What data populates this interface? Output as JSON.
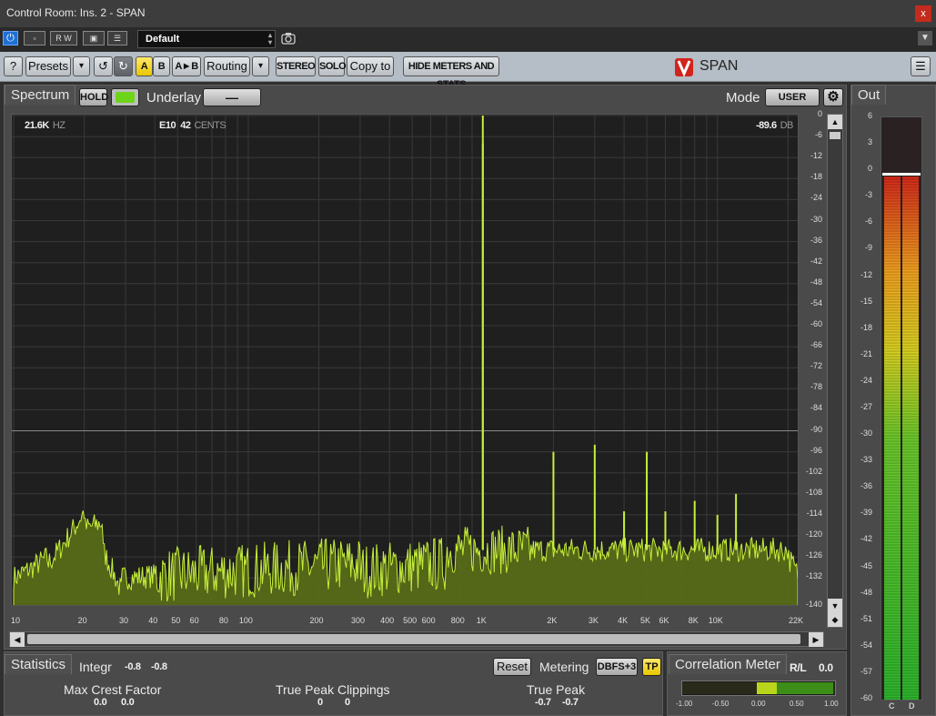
{
  "window": {
    "title": "Control Room: Ins. 2 - SPAN",
    "close_glyph": "x"
  },
  "host_toolbar": {
    "buttons": [
      "power-icon",
      "bypass-icon",
      "R",
      "W",
      "compare-icon",
      "list-icon"
    ],
    "rw_labels": [
      "R",
      "W"
    ],
    "preset_value": "Default",
    "snapshot_icon": "camera-icon"
  },
  "plugin_toolbar": {
    "help": "?",
    "presets": "Presets",
    "dropdown_glyph": "▾",
    "undo_glyph": "↺",
    "redo_glyph": "↻",
    "a": "A",
    "b": "B",
    "a_to_b": "A►B",
    "routing": "Routing",
    "stereo": "STEREO",
    "solo": "SOLO",
    "copy_to": "Copy to",
    "hide_meters": "HIDE METERS AND STATS",
    "logo": "SPAN",
    "menu_icon": "hamburger-icon"
  },
  "spectrum": {
    "tab": "Spectrum",
    "hold": "HOLD",
    "underlay_label": "Underlay",
    "underlay_value": "—",
    "mode_label": "Mode",
    "mode_value": "USER",
    "settings_icon": "gear-icon",
    "readout_freq": "21.6K",
    "readout_freq_unit": "HZ",
    "readout_note": "E10",
    "readout_cents": "42",
    "readout_cents_unit": "CENTS",
    "readout_level": "-89.6",
    "readout_level_unit": "DB",
    "db_ticks": [
      "0",
      "-6",
      "-12",
      "-18",
      "-24",
      "-30",
      "-36",
      "-42",
      "-48",
      "-54",
      "-60",
      "-66",
      "-72",
      "-78",
      "-84",
      "-90",
      "-96",
      "-102",
      "-108",
      "-114",
      "-120",
      "-126",
      "-132",
      "-140"
    ],
    "freq_ticks": [
      {
        "label": "10",
        "hz": 10
      },
      {
        "label": "20",
        "hz": 20
      },
      {
        "label": "30",
        "hz": 30
      },
      {
        "label": "40",
        "hz": 40
      },
      {
        "label": "50",
        "hz": 50
      },
      {
        "label": "60",
        "hz": 60
      },
      {
        "label": "80",
        "hz": 80
      },
      {
        "label": "100",
        "hz": 100
      },
      {
        "label": "200",
        "hz": 200
      },
      {
        "label": "300",
        "hz": 300
      },
      {
        "label": "400",
        "hz": 400
      },
      {
        "label": "500",
        "hz": 500
      },
      {
        "label": "600",
        "hz": 600
      },
      {
        "label": "800",
        "hz": 800
      },
      {
        "label": "1K",
        "hz": 1000
      },
      {
        "label": "2K",
        "hz": 2000
      },
      {
        "label": "3K",
        "hz": 3000
      },
      {
        "label": "4K",
        "hz": 4000
      },
      {
        "label": "5K",
        "hz": 5000
      },
      {
        "label": "6K",
        "hz": 6000
      },
      {
        "label": "8K",
        "hz": 8000
      },
      {
        "label": "10K",
        "hz": 10000
      },
      {
        "label": "22K",
        "hz": 22000
      }
    ],
    "reference_line_db": -90,
    "harmonic_peaks": [
      {
        "hz": 1000,
        "db": 0
      },
      {
        "hz": 1000,
        "db": -8
      },
      {
        "hz": 2000,
        "db": -96
      },
      {
        "hz": 3000,
        "db": -94
      },
      {
        "hz": 4000,
        "db": -113
      },
      {
        "hz": 5000,
        "db": -96
      },
      {
        "hz": 6000,
        "db": -113
      },
      {
        "hz": 8000,
        "db": -110
      },
      {
        "hz": 10000,
        "db": -114
      },
      {
        "hz": 12000,
        "db": -108
      }
    ],
    "scroll_up": "▲",
    "scroll_down": "▼",
    "scroll_left": "◀",
    "scroll_right": "▶",
    "scroll_reset": "◆"
  },
  "statistics": {
    "tab": "Statistics",
    "integr_label": "Integr",
    "integr_values": [
      "-0.8",
      "-0.8"
    ],
    "reset": "Reset",
    "metering_label": "Metering",
    "metering_value": "DBFS+3",
    "tp": "TP",
    "max_crest_label": "Max Crest Factor",
    "max_crest_values": [
      "0.0",
      "0.0"
    ],
    "tp_clippings_label": "True Peak Clippings",
    "tp_clippings_values": [
      "0",
      "0"
    ],
    "true_peak_label": "True Peak",
    "true_peak_values": [
      "-0.7",
      "-0.7"
    ]
  },
  "correlation": {
    "tab": "Correlation Meter",
    "rl_label": "R/L",
    "rl_value": "0.0",
    "ticks": [
      "-1.00",
      "-0.50",
      "0.00",
      "0.50",
      "1.00"
    ]
  },
  "out_meter": {
    "tab": "Out",
    "ticks": [
      "6",
      "3",
      "0",
      "-3",
      "-6",
      "-9",
      "-12",
      "-15",
      "-18",
      "-21",
      "-24",
      "-27",
      "-30",
      "-33",
      "-36",
      "-39",
      "-42",
      "-45",
      "-48",
      "-51",
      "-54",
      "-57",
      "-60"
    ],
    "channels": [
      "C",
      "D"
    ],
    "peak_db": -0.7
  },
  "colors": {
    "spectrum_fill": "#5a6e16",
    "spectrum_line": "#c6ef3a",
    "accent_yellow": "#f2d200",
    "meter_red": "#d42a1a",
    "meter_green": "#2db52d"
  }
}
